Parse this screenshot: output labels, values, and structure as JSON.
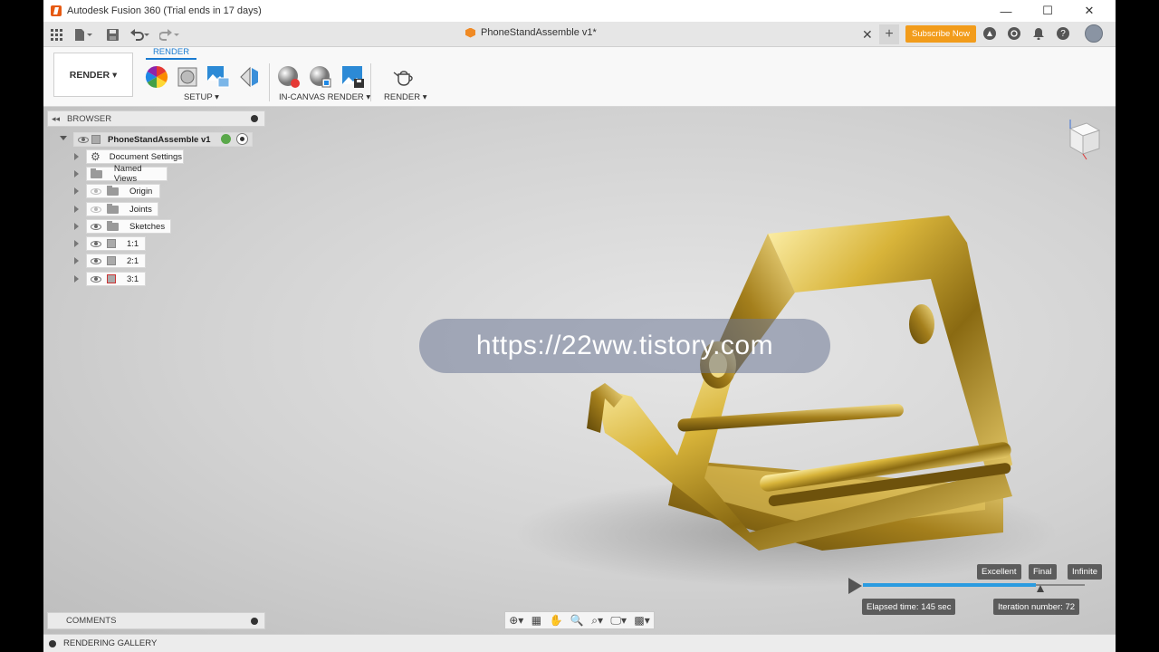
{
  "window": {
    "title": "Autodesk Fusion 360 (Trial ends in 17 days)",
    "minimize": "—",
    "maximize": "☐",
    "close": "✕"
  },
  "tabbar": {
    "doc_title": "PhoneStandAssemble v1*",
    "close": "✕",
    "new_tab": "+",
    "subscribe": "Subscribe Now",
    "help": "?"
  },
  "ribbon": {
    "workspace": "RENDER ▾",
    "active_tab": "RENDER",
    "groups": {
      "setup": "SETUP ▾",
      "in_canvas": "IN-CANVAS RENDER ▾",
      "render": "RENDER ▾"
    }
  },
  "browser": {
    "header": "BROWSER",
    "collapse": "◂◂",
    "root": "PhoneStandAssemble v1",
    "items": [
      {
        "label": "Document Settings",
        "kind": "settings"
      },
      {
        "label": "Named Views",
        "kind": "folder"
      },
      {
        "label": "Origin",
        "kind": "folder",
        "eye": "off"
      },
      {
        "label": "Joints",
        "kind": "folder",
        "eye": "off"
      },
      {
        "label": "Sketches",
        "kind": "folder",
        "eye": "on"
      },
      {
        "label": "1:1",
        "kind": "component",
        "eye": "on"
      },
      {
        "label": "2:1",
        "kind": "component",
        "eye": "on"
      },
      {
        "label": "3:1",
        "kind": "component",
        "eye": "on"
      }
    ]
  },
  "comments": "COMMENTS",
  "gallery": "RENDERING GALLERY",
  "watermark": "https://22ww.tistory.com",
  "render_progress": {
    "quality_levels": [
      "Excellent",
      "Final",
      "Infinite"
    ],
    "progress_fraction": 0.78,
    "elapsed": "Elapsed time: 145 sec",
    "iteration": "Iteration number: 72"
  },
  "colors": {
    "accent": "#1a7bd1",
    "subscribe": "#f29c1b",
    "gold": "#c9a227"
  },
  "icons": {
    "app": "fusion-logo-icon",
    "grid": "app-grid-icon",
    "file": "file-icon",
    "save": "save-icon",
    "undo": "undo-icon",
    "redo": "redo-icon"
  }
}
